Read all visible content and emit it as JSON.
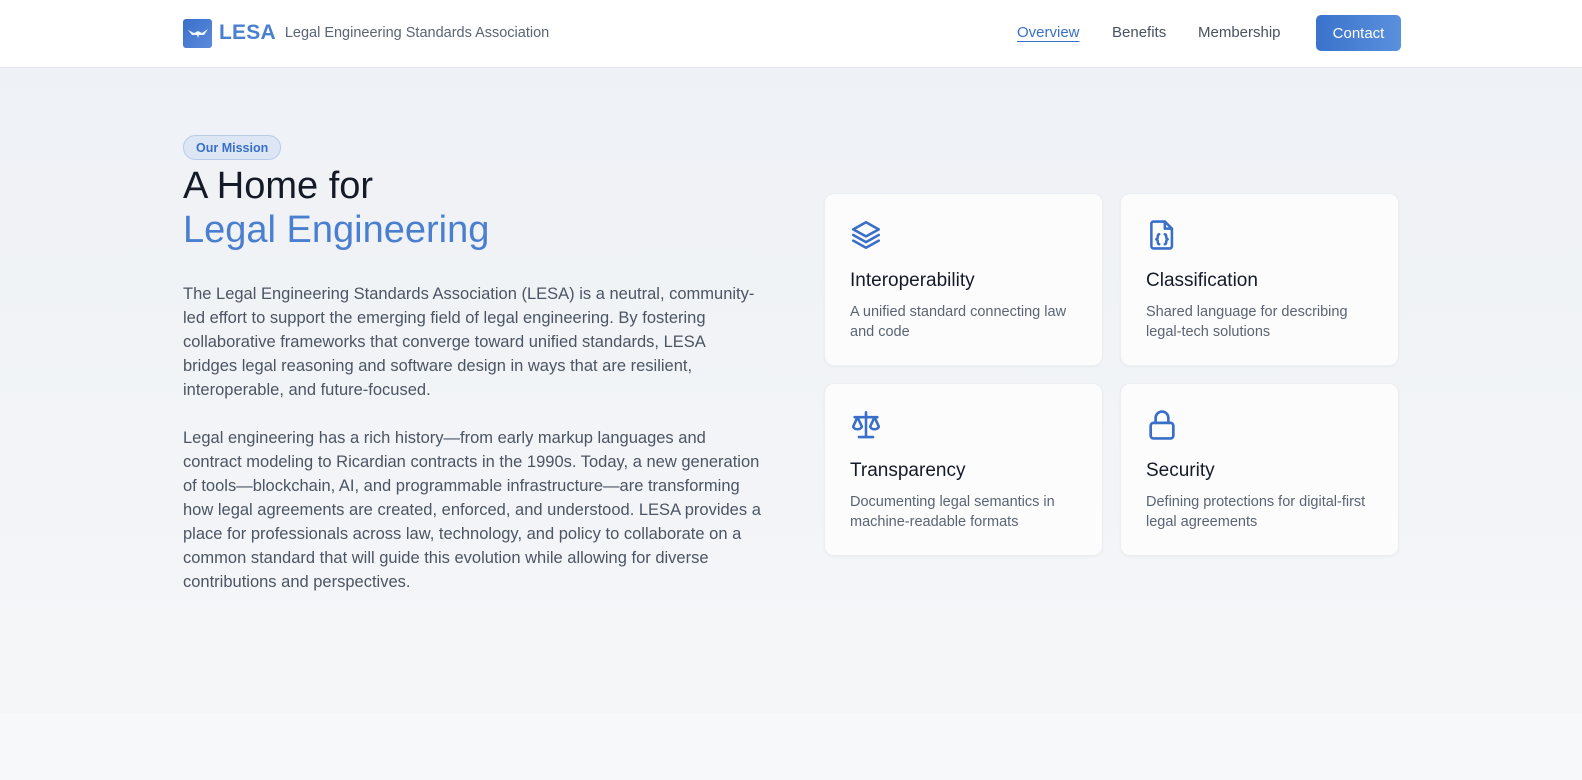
{
  "header": {
    "logo_icon": "eagle-icon",
    "brand_name": "LESA",
    "brand_full": "Legal Engineering Standards Association",
    "nav": [
      {
        "label": "Overview",
        "active": true
      },
      {
        "label": "Benefits",
        "active": false
      },
      {
        "label": "Membership",
        "active": false
      }
    ],
    "contact_label": "Contact"
  },
  "hero": {
    "badge": "Our Mission",
    "title_line1": "A Home for",
    "title_line2": "Legal Engineering",
    "paragraphs": [
      "The Legal Engineering Standards Association (LESA) is a neutral, community-led effort to support the emerging field of legal engineering. By fostering collaborative frameworks that converge toward unified standards, LESA bridges legal reasoning and software design in ways that are resilient, interoperable, and future-focused.",
      "Legal engineering has a rich history—from early markup languages and contract modeling to Ricardian contracts in the 1990s. Today, a new generation of tools—blockchain, AI, and programmable infrastructure—are transforming how legal agreements are created, enforced, and understood. LESA provides a place for professionals across law, technology, and policy to collaborate on a common standard that will guide this evolution while allowing for diverse contributions and perspectives."
    ]
  },
  "features": [
    {
      "icon": "layers-icon",
      "title": "Interoperability",
      "desc": "A unified standard connecting law and code"
    },
    {
      "icon": "code-file-icon",
      "title": "Classification",
      "desc": "Shared language for describing legal-tech solutions"
    },
    {
      "icon": "scales-icon",
      "title": "Transparency",
      "desc": "Documenting legal semantics in machine-readable formats"
    },
    {
      "icon": "lock-icon",
      "title": "Security",
      "desc": "Defining protections for digital-first legal agreements"
    }
  ],
  "colors": {
    "accent": "#4a7fd0",
    "accent_dark": "#3a6fc9",
    "text_dark": "#141b27",
    "text_body": "#4b5563"
  }
}
